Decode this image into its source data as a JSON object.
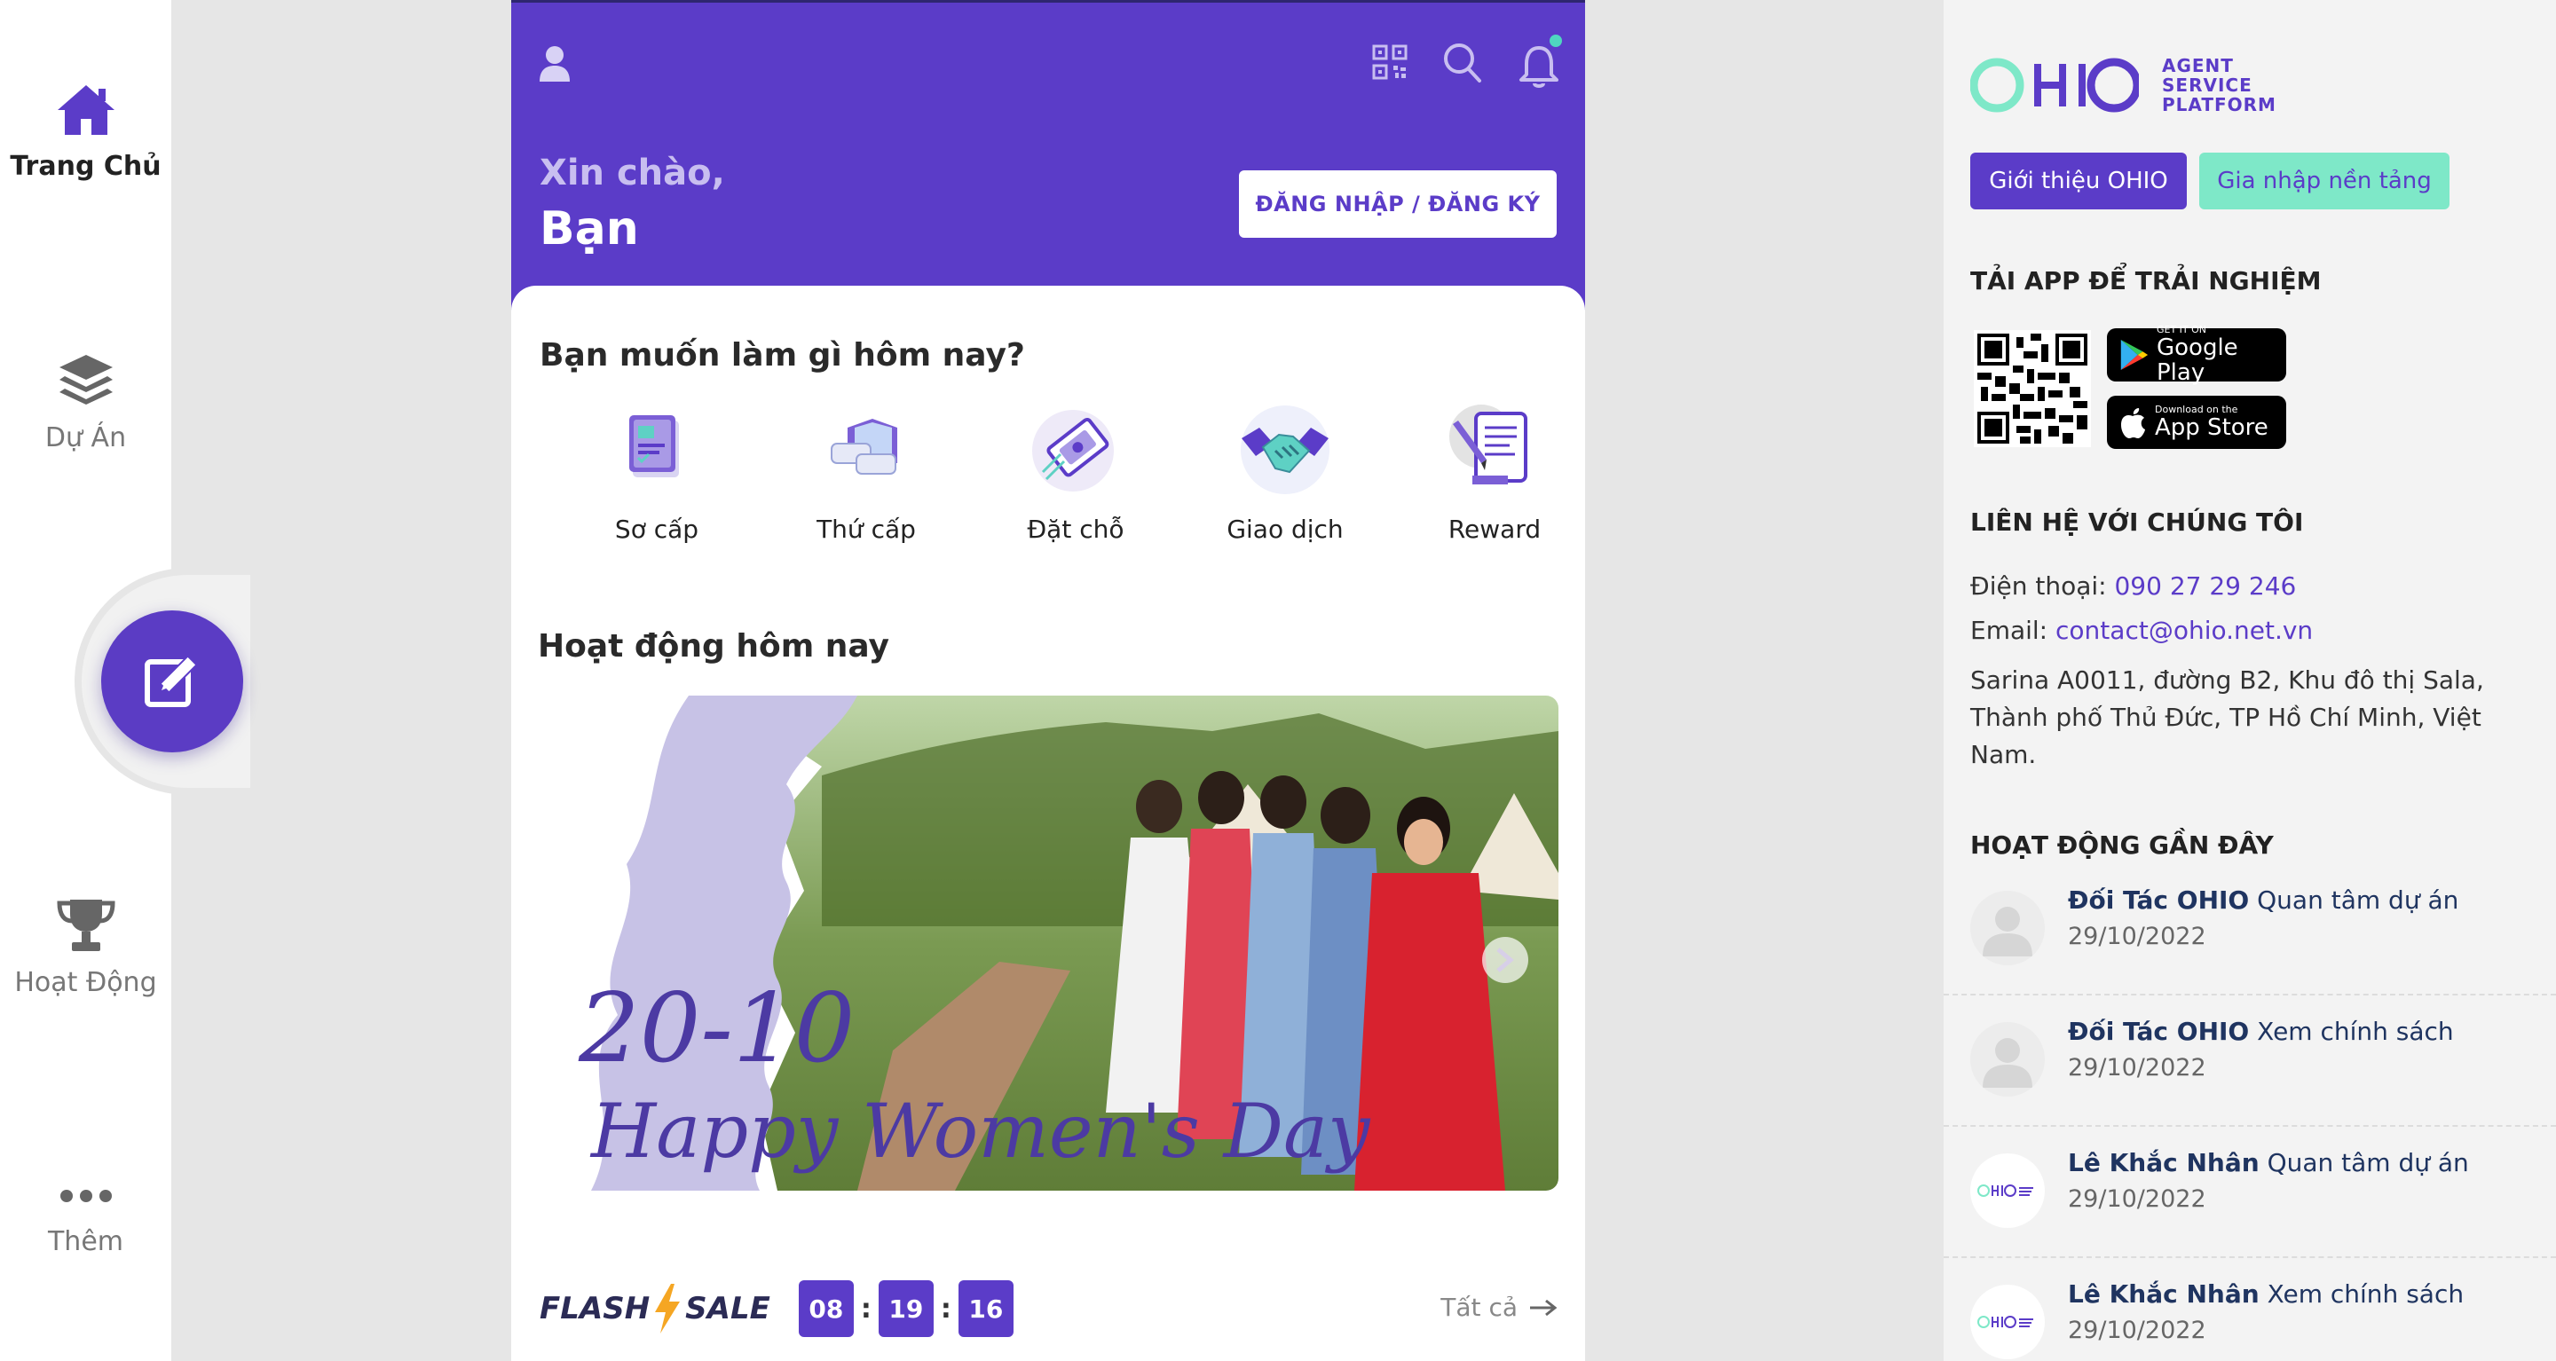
{
  "nav": {
    "items": [
      {
        "label": "Trang Chủ",
        "icon": "home-icon",
        "active": true
      },
      {
        "label": "Dự Án",
        "icon": "layers-icon",
        "active": false
      },
      {
        "label": "Hoạt Động",
        "icon": "trophy-icon",
        "active": false
      },
      {
        "label": "Thêm",
        "icon": "more-icon",
        "active": false
      }
    ],
    "fab_icon": "edit-icon"
  },
  "header": {
    "greeting": "Xin chào,",
    "user": "Bạn",
    "login_label": "ĐĂNG NHẬP / ĐĂNG KÝ",
    "icons": [
      "user-icon",
      "qr-scan-icon",
      "search-icon",
      "bell-icon"
    ]
  },
  "main": {
    "question": "Bạn muốn làm gì hôm nay?",
    "actions": [
      {
        "label": "Sơ cấp",
        "icon": "primary-market-icon"
      },
      {
        "label": "Thứ cấp",
        "icon": "secondary-market-icon"
      },
      {
        "label": "Đặt chỗ",
        "icon": "booking-ticket-icon"
      },
      {
        "label": "Giao dịch",
        "icon": "handshake-icon"
      },
      {
        "label": "Reward",
        "icon": "reward-document-icon"
      }
    ],
    "activities_title": "Hoạt động hôm nay",
    "banner": {
      "line1": "20-10",
      "line2": "Happy Women's Day"
    },
    "flash": {
      "word1": "FLASH",
      "word2": "SALE",
      "hours": "08",
      "minutes": "19",
      "seconds": "16",
      "see_all": "Tất cả"
    }
  },
  "right": {
    "logo_word": "OHIO",
    "logo_sub": [
      "AGENT",
      "SERVICE",
      "PLATFORM"
    ],
    "intro_btn": "Giới thiệu OHIO",
    "join_btn": "Gia nhập nền tảng",
    "download_title": "TẢI APP ĐỂ TRẢI NGHIỆM",
    "google_small": "GET IT ON",
    "google_big": "Google Play",
    "apple_small": "Download on the",
    "apple_big": "App Store",
    "contact_title": "LIÊN HỆ VỚI CHÚNG TÔI",
    "phone_label": "Điện thoại:",
    "phone": "090 27 29 246",
    "email_label": "Email:",
    "email": "contact@ohio.net.vn",
    "address": "Sarina A0011, đường B2, Khu đô thị Sala, Thành phố Thủ Đức, TP Hồ Chí Minh, Việt Nam.",
    "recent_title": "HOẠT ĐỘNG GẦN ĐÂY",
    "recent": [
      {
        "name": "Đối Tác OHIO",
        "action": "Quan tâm dự án",
        "date": "29/10/2022",
        "avatar": "default"
      },
      {
        "name": "Đối Tác OHIO",
        "action": "Xem chính sách",
        "date": "29/10/2022",
        "avatar": "default"
      },
      {
        "name": "Lê Khắc Nhân",
        "action": "Quan tâm dự án",
        "date": "29/10/2022",
        "avatar": "ohio"
      },
      {
        "name": "Lê Khắc Nhân",
        "action": "Xem chính sách",
        "date": "29/10/2022",
        "avatar": "ohio"
      }
    ]
  },
  "colors": {
    "brand": "#5b3cc8",
    "accent": "#7ee8c8",
    "notification_dot": "#4fd6c0"
  }
}
